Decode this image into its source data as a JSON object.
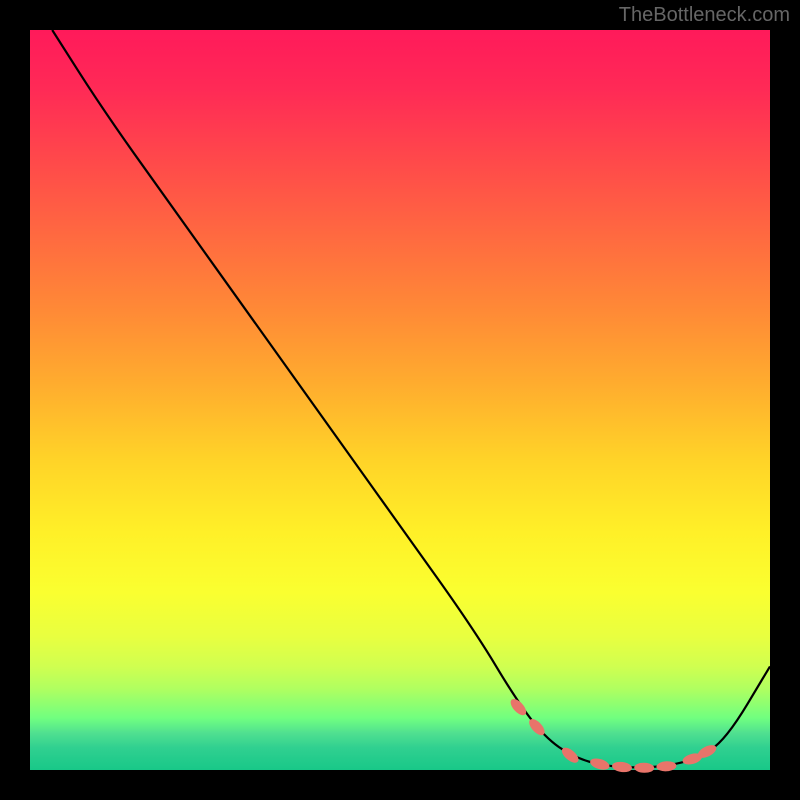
{
  "watermark": "TheBottleneck.com",
  "chart_data": {
    "type": "line",
    "title": "",
    "xlabel": "",
    "ylabel": "",
    "xlim": [
      0,
      100
    ],
    "ylim": [
      0,
      100
    ],
    "x": [
      3,
      10,
      20,
      30,
      40,
      50,
      60,
      66,
      70,
      74,
      78,
      82,
      86,
      90,
      94,
      100
    ],
    "values": [
      100,
      89,
      75,
      61,
      47,
      33,
      19,
      9,
      4,
      1.5,
      0.5,
      0.3,
      0.5,
      1.5,
      4,
      14
    ],
    "markers": {
      "x": [
        66,
        68.5,
        73,
        77,
        80,
        83,
        86,
        89.5,
        91.5
      ],
      "y": [
        8.5,
        5.8,
        2.0,
        0.8,
        0.4,
        0.3,
        0.5,
        1.5,
        2.5
      ],
      "color": "#e8746a"
    },
    "line_color": "#000000",
    "background": "gradient-red-yellow-green"
  }
}
